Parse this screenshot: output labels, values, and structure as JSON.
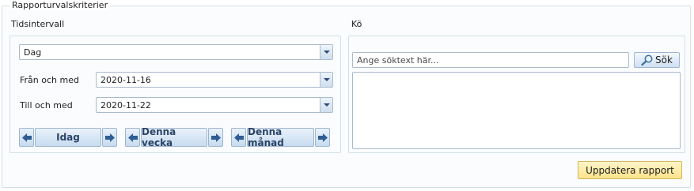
{
  "groupbox": {
    "title": "Rapporturvalskriterier"
  },
  "time_interval": {
    "heading": "Tidsintervall",
    "period_select": {
      "value": "Dag"
    },
    "from": {
      "label": "Från och med",
      "value": "2020-11-16"
    },
    "to": {
      "label": "Till och med",
      "value": "2020-11-22"
    },
    "nav_buttons": [
      {
        "label": "Idag"
      },
      {
        "label": "Denna vecka"
      },
      {
        "label": "Denna månad"
      }
    ]
  },
  "queue": {
    "heading": "Kö",
    "search": {
      "placeholder": "Ange söktext här...",
      "value": ""
    },
    "search_button": {
      "label": "Sök"
    }
  },
  "actions": {
    "update_report": "Uppdatera rapport"
  }
}
